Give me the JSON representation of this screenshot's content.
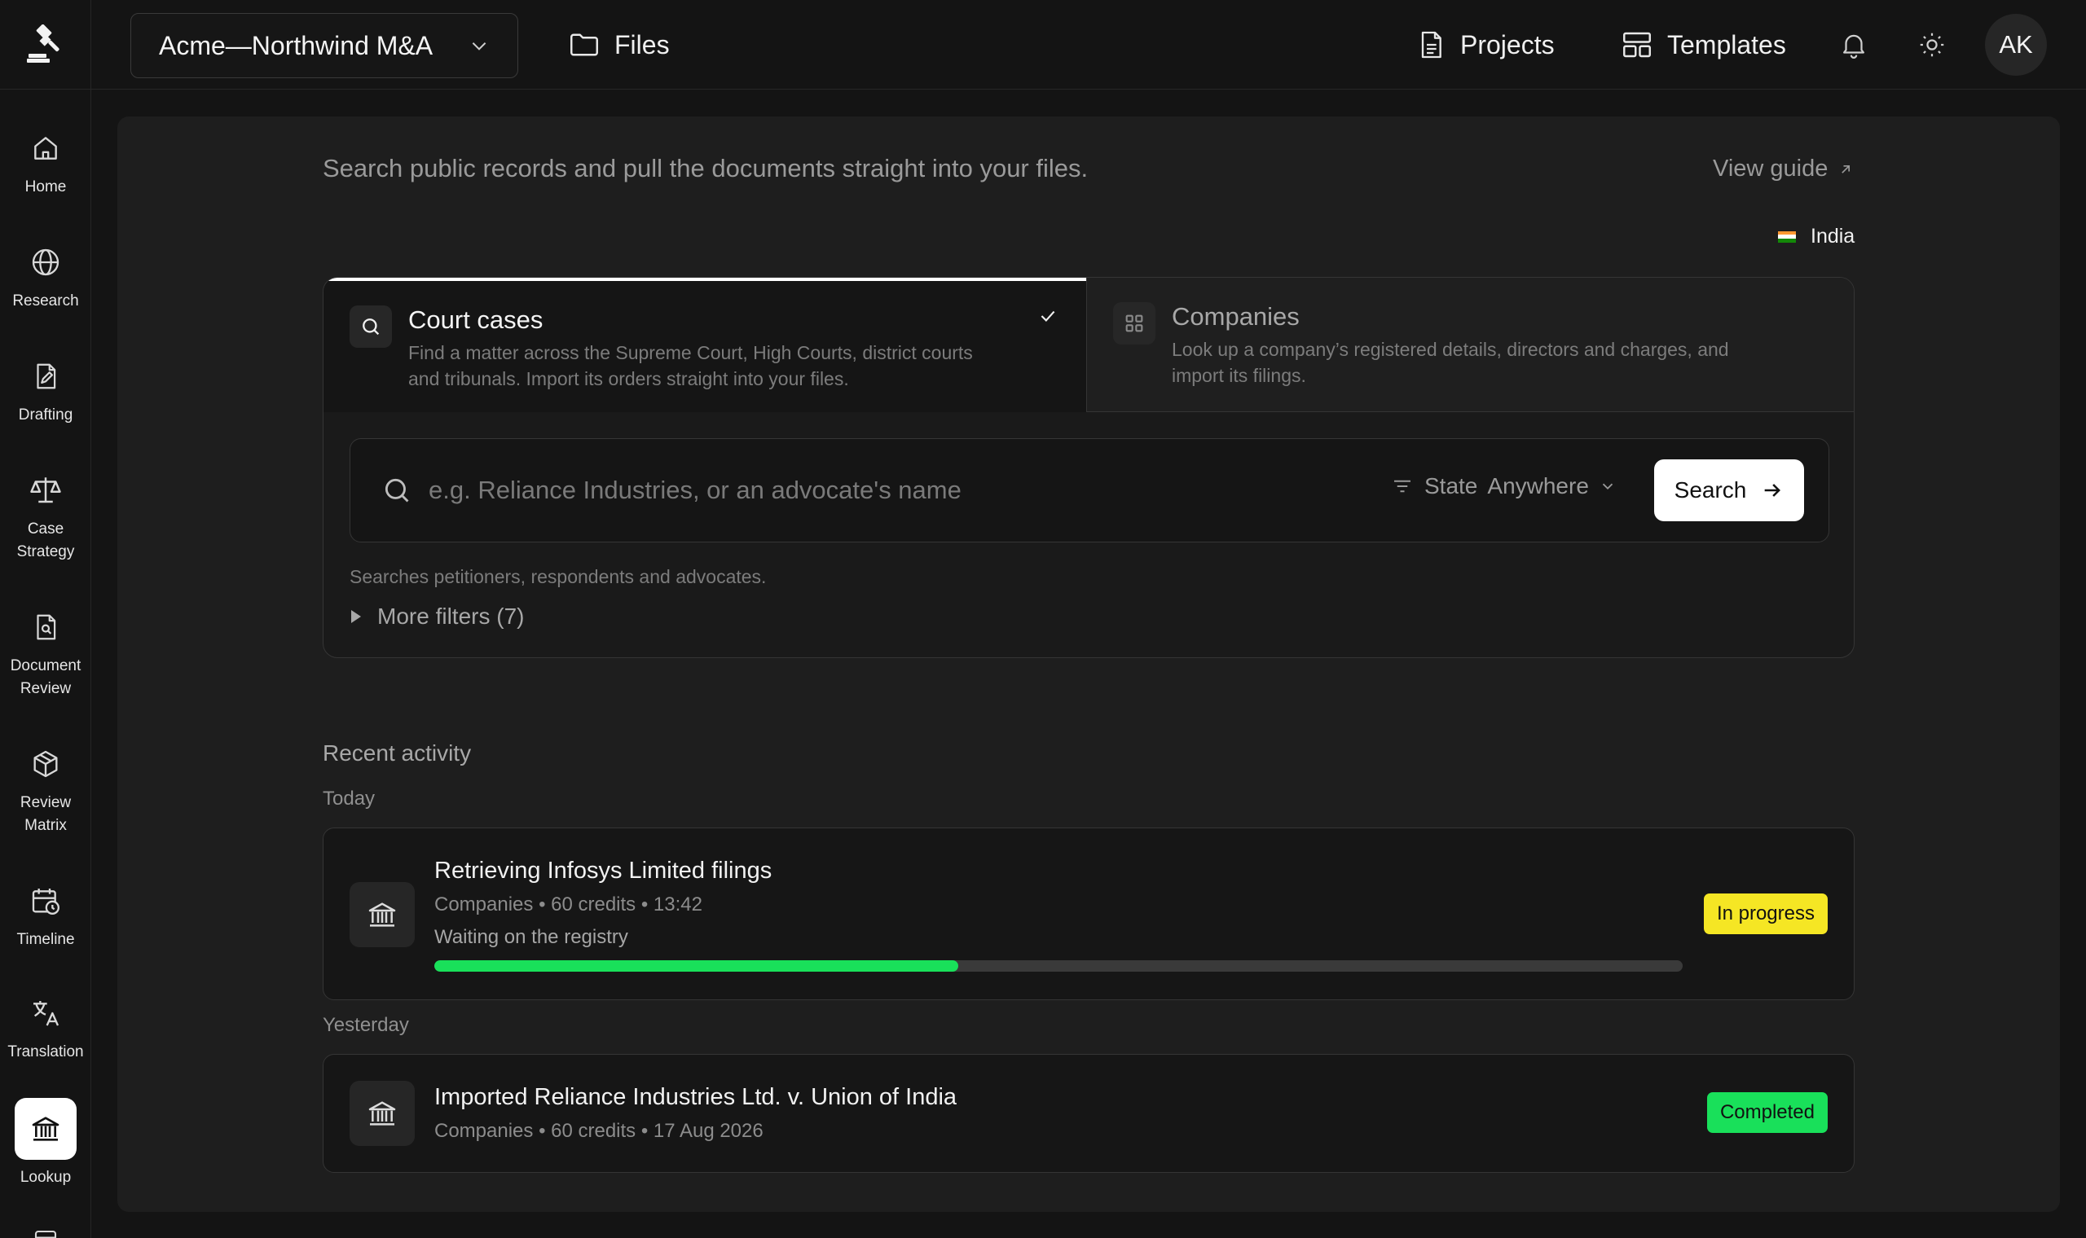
{
  "rail": {
    "items": [
      {
        "label": "Home",
        "icon": "home-icon"
      },
      {
        "label": "Research",
        "icon": "globe-icon"
      },
      {
        "label": "Drafting",
        "icon": "pen-document-icon"
      },
      {
        "label": "Case\nStrategy",
        "icon": "scales-icon"
      },
      {
        "label": "Document\nReview",
        "icon": "document-search-icon"
      },
      {
        "label": "Review\nMatrix",
        "icon": "cube-icon"
      },
      {
        "label": "Timeline",
        "icon": "calendar-clock-icon"
      },
      {
        "label": "Translation",
        "icon": "translate-icon"
      },
      {
        "label": "Lookup",
        "icon": "bank-icon",
        "active": true
      }
    ]
  },
  "topbar": {
    "workspace": "Acme—Northwind M&A",
    "files": "Files",
    "projects": "Projects",
    "templates": "Templates",
    "avatar": "AK"
  },
  "main": {
    "subtitle": "Search public records and pull the documents straight into your files.",
    "view_guide": "View guide",
    "country": "India"
  },
  "tabs": {
    "court": {
      "title": "Court cases",
      "desc": "Find a matter across the Supreme Court, High Courts, district courts and tribunals. Import its orders straight into your files."
    },
    "companies": {
      "title": "Companies",
      "desc": "Look up a company’s registered details, directors and charges, and import its filings."
    }
  },
  "search": {
    "placeholder": "e.g. Reliance Industries, or an advocate's name",
    "value": "",
    "state_label": "State",
    "state_value": "Anywhere",
    "button": "Search",
    "hint": "Searches petitioners, respondents and advocates.",
    "more_filters": "More filters (7)"
  },
  "recent": {
    "title": "Recent activity",
    "groups": [
      {
        "label": "Today",
        "items": [
          {
            "title": "Retrieving Infosys Limited filings",
            "meta": "Companies • 60 credits • 13:42",
            "status_text": "Waiting on the registry",
            "progress": 0.42,
            "badge": "In progress",
            "badge_color": "#f5e624"
          }
        ]
      },
      {
        "label": "Yesterday",
        "items": [
          {
            "title": "Imported Reliance Industries Ltd. v. Union of India",
            "meta": "Companies • 60 credits • 17 Aug 2026",
            "badge": "Completed",
            "badge_color": "#19e05a"
          }
        ]
      }
    ]
  },
  "colors": {
    "background": "#141414",
    "panel": "#1e1e1e",
    "progress": "#19e05a",
    "in_progress": "#f5e624",
    "completed": "#19e05a"
  }
}
